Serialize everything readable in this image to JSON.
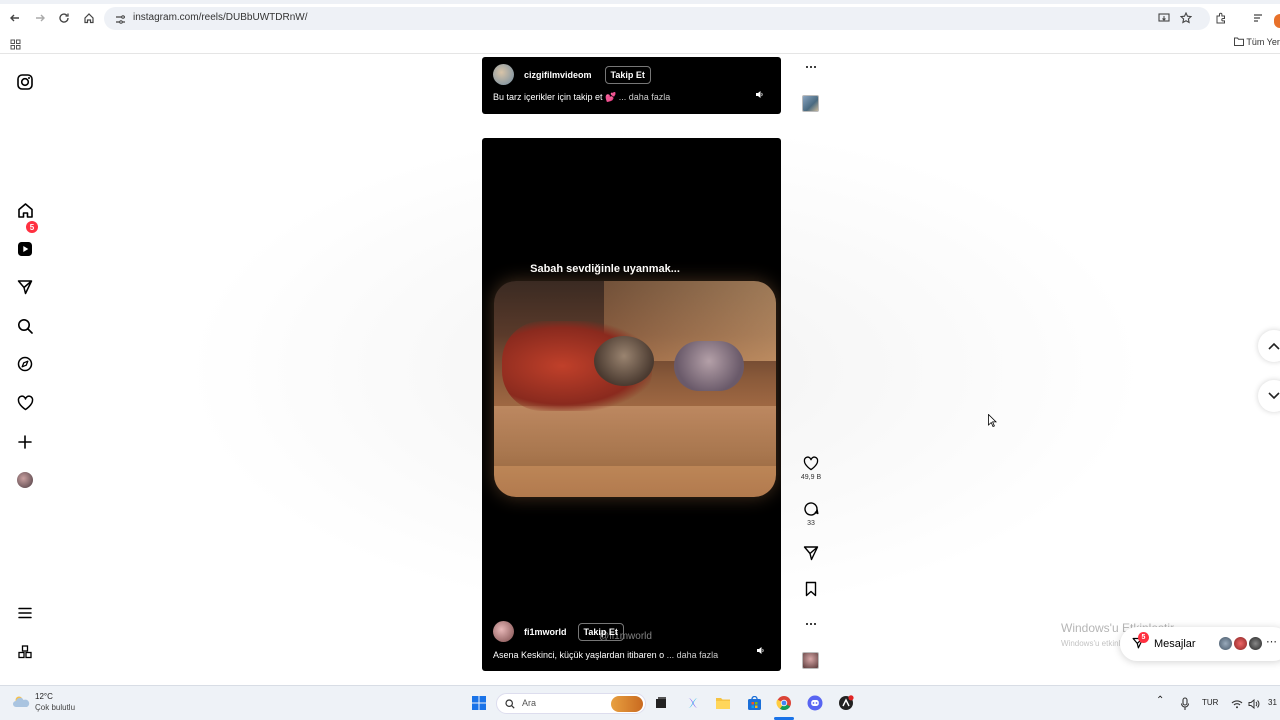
{
  "browser": {
    "url": "instagram.com/reels/DUBbUWTDRnW/",
    "bookmark_folder": "Tüm Yer"
  },
  "sidebar": {
    "items": [
      {
        "name": "instagram-logo-icon"
      },
      {
        "name": "home-icon"
      },
      {
        "name": "reels-icon"
      },
      {
        "name": "messages-icon"
      },
      {
        "name": "search-icon"
      },
      {
        "name": "explore-icon"
      },
      {
        "name": "heart-icon"
      },
      {
        "name": "create-icon"
      },
      {
        "name": "profile-avatar"
      },
      {
        "name": "menu-icon"
      },
      {
        "name": "more-apps-icon"
      }
    ],
    "notification_count": "5"
  },
  "reel_top": {
    "author": "cizgifilmvideom",
    "follow_label": "Takip Et",
    "caption": "Bu tarz içerikler için takip et 💕",
    "more_label": "... daha fazla"
  },
  "reel_main": {
    "overlay_text": "Sabah sevdiğinle uyanmak...",
    "author": "fi1mworld",
    "follow_label": "Takip Et",
    "watermark": "@fi1mworld",
    "caption": "Asena Keskinci, küçük yaşlardan itibaren o",
    "more_label": "... daha fazla",
    "likes": "49,9 B",
    "comments": "33"
  },
  "windows_activation": {
    "title": "Windows'u Etkinleştir",
    "subtitle": "Windows'u etkinleştirmek için Ayarlar'a gidin"
  },
  "messages": {
    "label": "Mesajlar",
    "badge": "5"
  },
  "taskbar": {
    "temperature": "12°C",
    "weather": "Çok bulutlu",
    "search_label": "Ara",
    "language": "TUR",
    "clock": "31"
  }
}
